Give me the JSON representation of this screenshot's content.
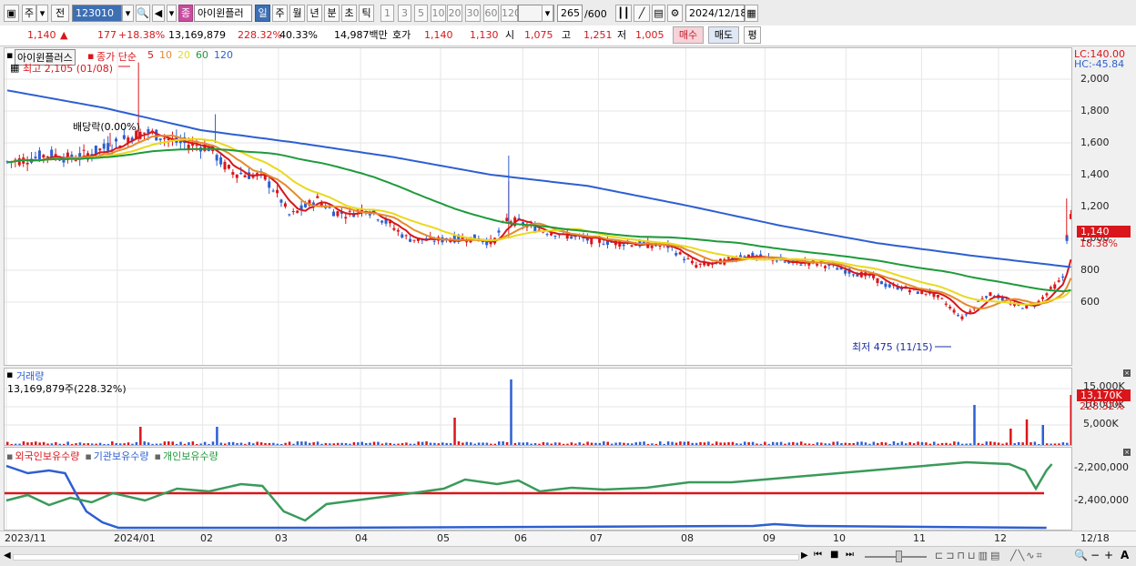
{
  "toolbar": {
    "period_unit": "주",
    "prev_label": "전",
    "stock_code": "123010",
    "stock_badge": "종",
    "stock_name": "아이윈플러",
    "periods": [
      "일",
      "주",
      "월",
      "년",
      "분",
      "초",
      "틱"
    ],
    "selected_period": "일",
    "intervals": [
      "1",
      "3",
      "5",
      "10",
      "20",
      "30",
      "60",
      "120"
    ],
    "count": "265",
    "count_total": "/600",
    "date": "2024/12/18"
  },
  "quote": {
    "price": "1,140",
    "change": "177",
    "change_pct": "+18.38%",
    "volume": "13,169,879",
    "volume_ratio": "228.32%",
    "turnover": "40.33%",
    "amount": "14,987백만",
    "bid_label": "호가",
    "bid1": "1,140",
    "bid2": "1,130",
    "open_label": "시",
    "open": "1,075",
    "high_label": "고",
    "high": "1,251",
    "low_label": "저",
    "low": "1,005",
    "buy_label": "매수",
    "sell_label": "매도",
    "avg_label": "평"
  },
  "price_panel": {
    "stock_label": "아이윈플러스",
    "ma_label": "종가 단순",
    "ma_periods": [
      "5",
      "10",
      "20",
      "60",
      "120"
    ],
    "ma_colors": [
      "#d8161b",
      "#e48b2d",
      "#e9d91c",
      "#1e9a3a",
      "#2d5fd1"
    ],
    "high_note": "최고 2,105 (01/08)",
    "low_note": "최저 475 (11/15)",
    "dividend_note": "배당락(0.00%)",
    "lc": "LC:140.00",
    "hc": "HC:-45.84",
    "y_ticks": [
      "2,000",
      "1,800",
      "1,600",
      "1,400",
      "1,200",
      "1,000",
      "800",
      "600"
    ],
    "current_price": "1,140",
    "current_pct": "18.38%"
  },
  "volume_panel": {
    "title": "거래량",
    "summary": "13,169,879주(228.32%)",
    "y_ticks": [
      "15,000K",
      "10,000K",
      "5,000K"
    ],
    "current": "13,170K",
    "current_pct": "228.32%"
  },
  "holding_panel": {
    "legend": [
      "외국인보유수량",
      "기관보유수량",
      "개인보유수량"
    ],
    "legend_colors": [
      "#d8161b",
      "#2d5fd1",
      "#1e9a3a"
    ],
    "y_ticks": [
      "-2,200,000",
      "-2,400,000"
    ]
  },
  "x_axis": [
    "2023/11",
    "2024/01",
    "02",
    "03",
    "04",
    "05",
    "06",
    "07",
    "08",
    "09",
    "10",
    "11",
    "12",
    "12/18"
  ],
  "chart_data": {
    "type": "candlestick",
    "ylim": [
      400,
      2100
    ],
    "weekly_close_approx": [
      {
        "x": "2023/11",
        "y": 1520
      },
      {
        "x": "2023/12",
        "y": 1580
      },
      {
        "x": "2024/01",
        "y": 1650
      },
      {
        "x": "02",
        "y": 1560
      },
      {
        "x": "03",
        "y": 1150
      },
      {
        "x": "04",
        "y": 1140
      },
      {
        "x": "05",
        "y": 1000
      },
      {
        "x": "06",
        "y": 1060
      },
      {
        "x": "07",
        "y": 990
      },
      {
        "x": "08",
        "y": 820
      },
      {
        "x": "09",
        "y": 850
      },
      {
        "x": "10",
        "y": 740
      },
      {
        "x": "11",
        "y": 560
      },
      {
        "x": "12",
        "y": 680
      },
      {
        "x": "12/18",
        "y": 1140
      }
    ],
    "ma120_approx": [
      1930,
      1820,
      1680,
      1600,
      1510,
      1400,
      1330,
      1210,
      1080,
      970,
      890,
      820
    ]
  }
}
